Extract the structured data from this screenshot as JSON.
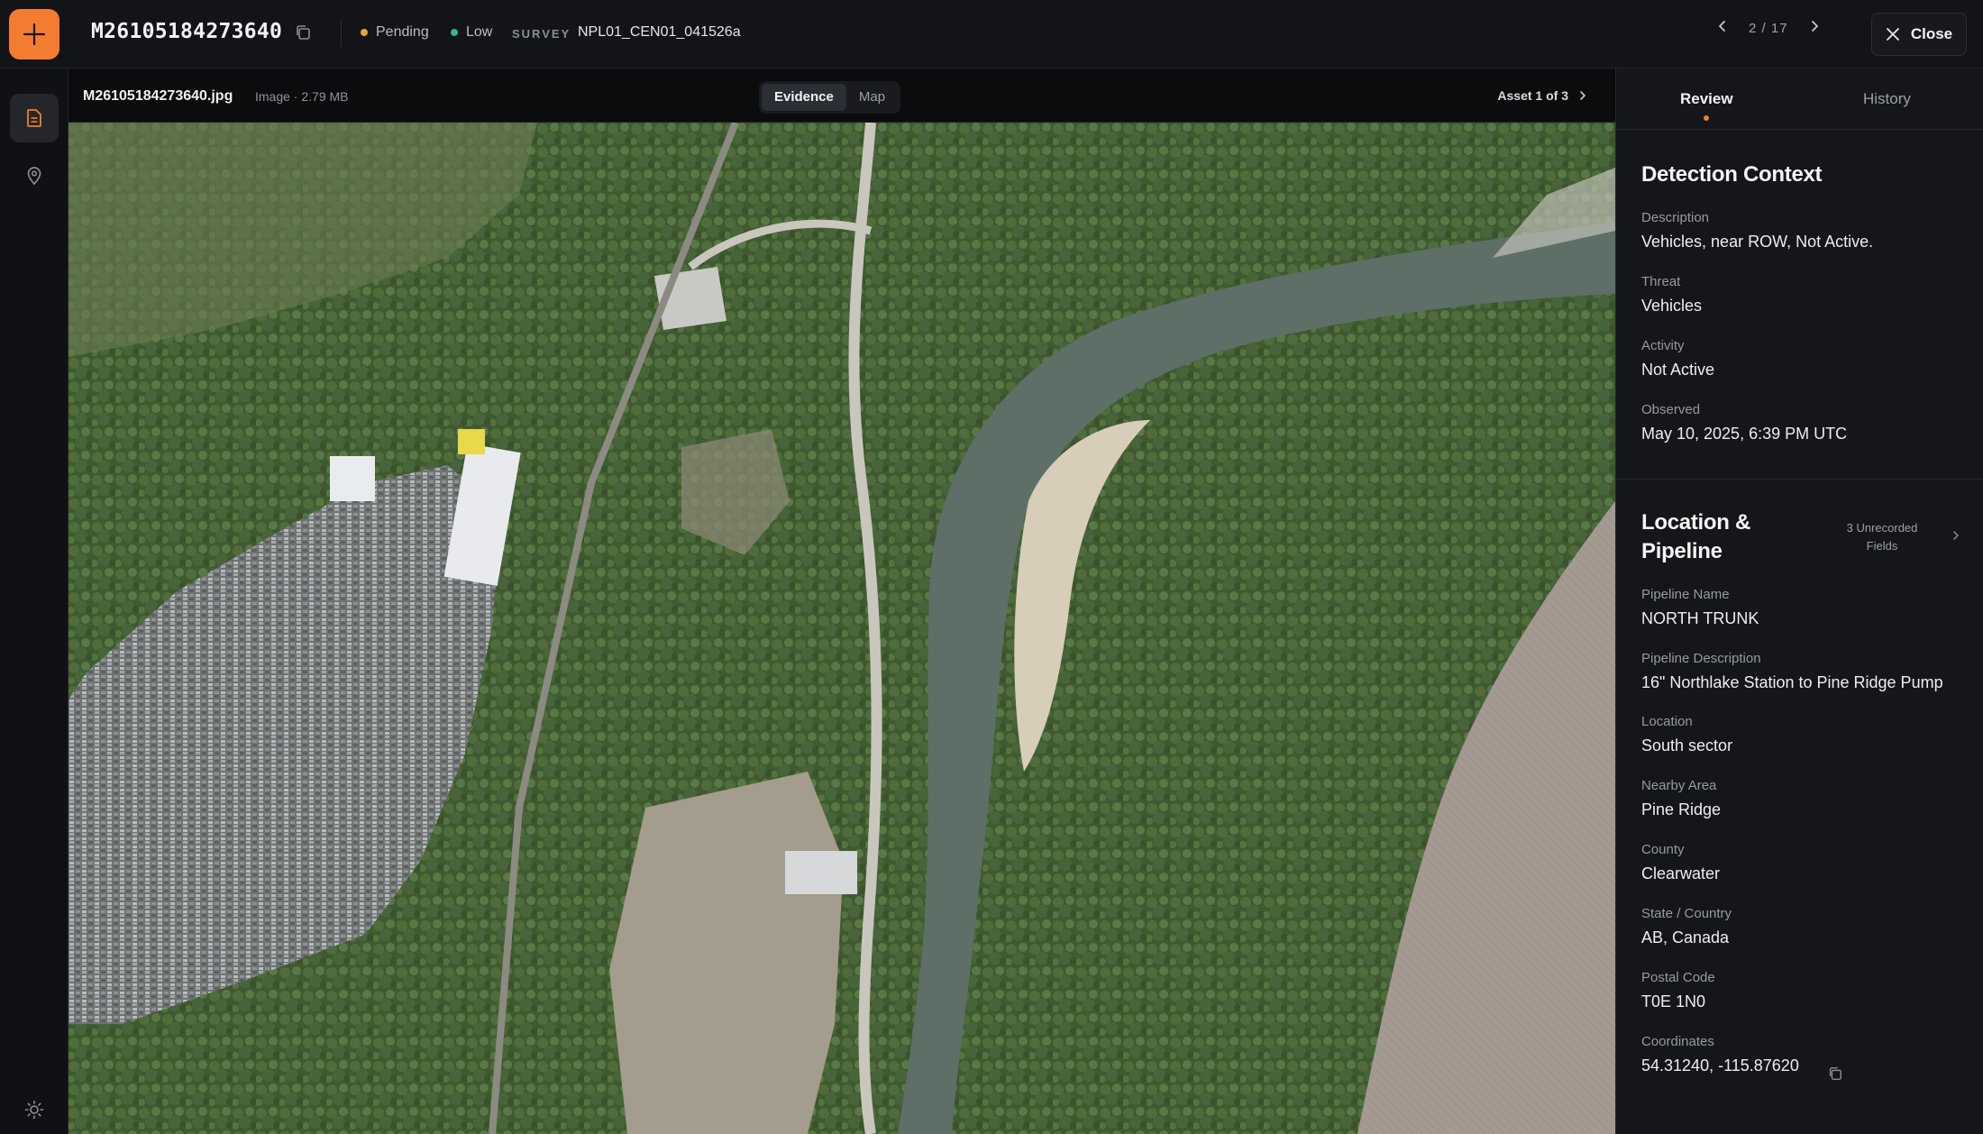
{
  "header": {
    "record_id": "M26105184273640",
    "status": "Pending",
    "status_color": "#e8a33a",
    "priority": "Low",
    "priority_color": "#3fb27f",
    "survey_label": "SURVEY",
    "survey_value": "NPL01_CEN01_041526a",
    "pager_current": "2",
    "pager_separator": "/",
    "pager_total": "17",
    "close_label": "Close",
    "accent_color": "#f47c30"
  },
  "rail": {
    "items": [
      {
        "icon": "document-icon",
        "active": true
      },
      {
        "icon": "map-pin-icon",
        "active": false
      }
    ],
    "bottom_icon": "sun-icon"
  },
  "viewer": {
    "file_name": "M26105184273640.jpg",
    "file_meta": "Image · 2.79 MB",
    "tabs": [
      {
        "label": "Evidence",
        "active": true
      },
      {
        "label": "Map",
        "active": false
      }
    ],
    "asset_nav": "Asset 1 of 3"
  },
  "panel": {
    "tabs": [
      {
        "label": "Review",
        "active": true
      },
      {
        "label": "History",
        "active": false
      }
    ],
    "detection": {
      "title": "Detection Context",
      "fields": [
        {
          "label": "Description",
          "value": "Vehicles, near ROW, Not Active."
        },
        {
          "label": "Threat",
          "value": "Vehicles"
        },
        {
          "label": "Activity",
          "value": "Not Active"
        },
        {
          "label": "Observed",
          "value": "May 10, 2025, 6:39 PM UTC"
        }
      ]
    },
    "location": {
      "title_line1": "Location &",
      "title_line2": "Pipeline",
      "unrecorded_line1": "3 Unrecorded",
      "unrecorded_line2": "Fields",
      "fields": [
        {
          "label": "Pipeline Name",
          "value": "NORTH TRUNK"
        },
        {
          "label": "Pipeline Description",
          "value": "16\" Northlake Station to Pine Ridge Pump"
        },
        {
          "label": "Location",
          "value": "South sector"
        },
        {
          "label": "Nearby Area",
          "value": "Pine Ridge"
        },
        {
          "label": "County",
          "value": "Clearwater"
        },
        {
          "label": "State / Country",
          "value": "AB, Canada"
        },
        {
          "label": "Postal Code",
          "value": "T0E 1N0"
        },
        {
          "label": "Coordinates",
          "value": "54.31240, -115.87620"
        }
      ]
    }
  }
}
